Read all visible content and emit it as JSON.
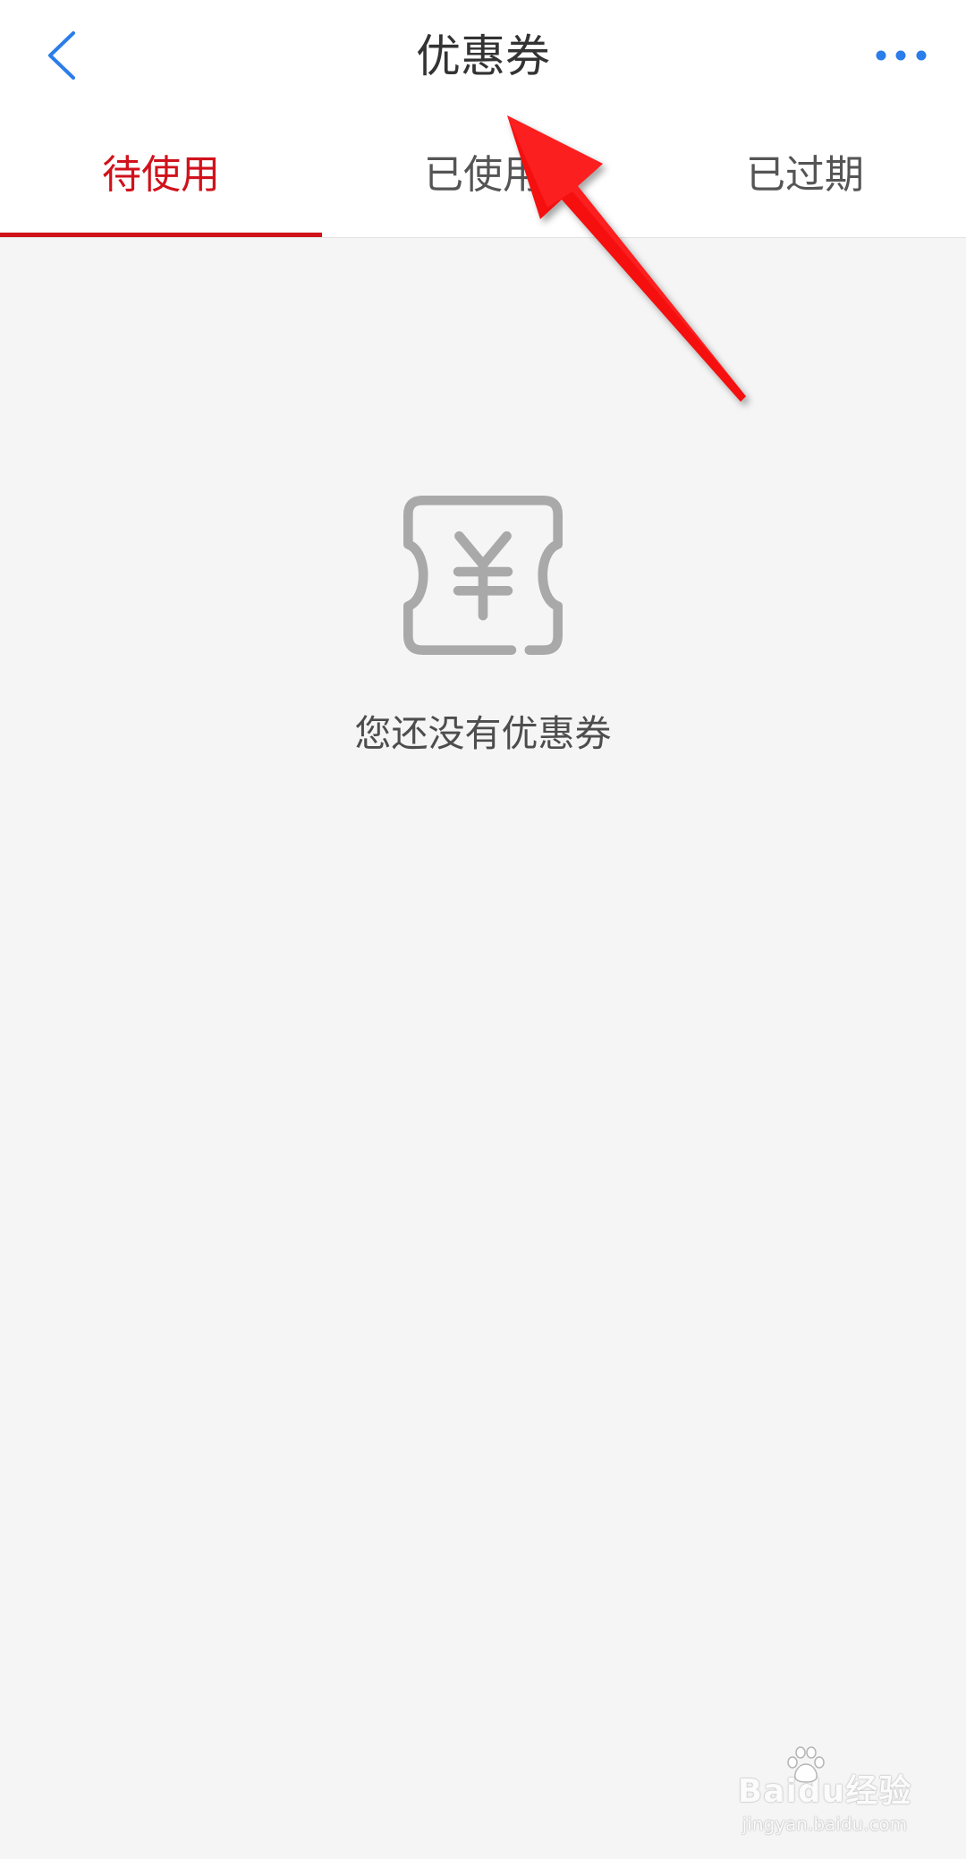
{
  "header": {
    "title": "优惠券",
    "back_icon": "chevron-left-icon",
    "more_icon": "more-dots-icon"
  },
  "tabs": [
    {
      "label": "待使用",
      "active": true
    },
    {
      "label": "已使用",
      "active": false
    },
    {
      "label": "已过期",
      "active": false
    }
  ],
  "empty_state": {
    "icon": "yen-coupon-icon",
    "message": "您还没有优惠券"
  },
  "watermark": {
    "logo": "Baidu经验",
    "url": "jingyan.baidu.com"
  },
  "colors": {
    "accent": "#d0121b",
    "link": "#2b7de9",
    "icon_gray": "#a9a9a9",
    "background": "#f5f5f5",
    "annotation_arrow": "#f50f0f"
  }
}
